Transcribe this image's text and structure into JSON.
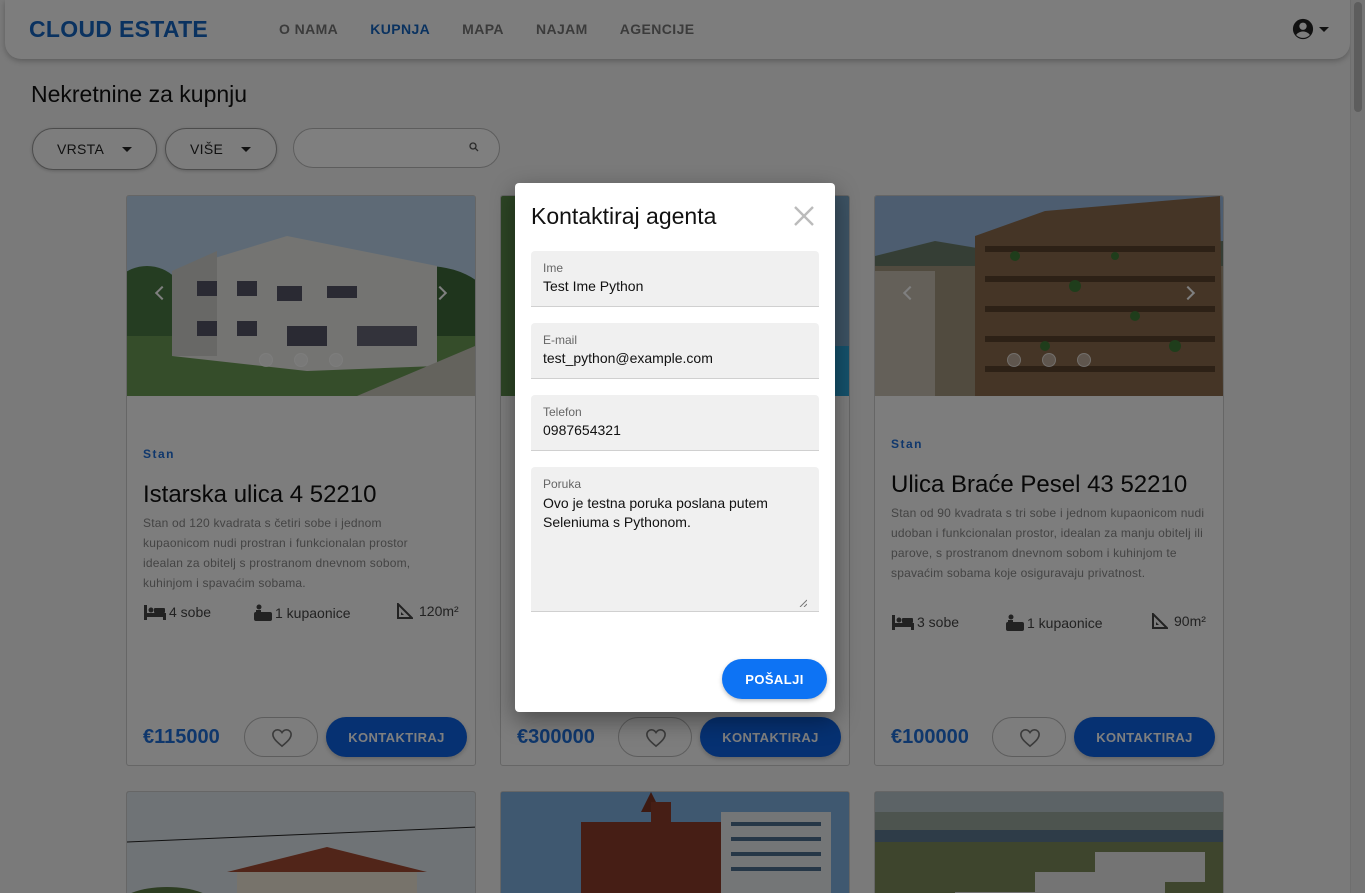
{
  "header": {
    "brand": "CLOUD ESTATE",
    "nav": [
      {
        "label": "O NAMA"
      },
      {
        "label": "KUPNJA",
        "active": true
      },
      {
        "label": "MAPA"
      },
      {
        "label": "NAJAM"
      },
      {
        "label": "AGENCIJE"
      }
    ],
    "account_icon": "account-circle-icon"
  },
  "page": {
    "title": "Nekretnine za kupnju",
    "filters": {
      "vrsta_label": "VRSTA",
      "vise_label": "VIŠE",
      "search_placeholder": ""
    }
  },
  "cards": [
    {
      "type": "Stan",
      "address": "Istarska ulica 4 52210",
      "description": "Stan od 120 kvadrata s četiri sobe i jednom kupaonicom nudi prostran i funkcionalan prostor idealan za obitelj s prostranom dnevnom sobom, kuhinjom i spavaćim sobama.",
      "rooms": "4 sobe",
      "bathrooms": "1 kupaonice",
      "area": "120m²",
      "price": "€115000",
      "contact_label": "KONTAKTIRAJ"
    },
    {
      "price": "€300000",
      "contact_label": "KONTAKTIRAJ"
    },
    {
      "type": "Stan",
      "address": "Ulica Braće Pesel 43 52210",
      "description": "Stan od 90 kvadrata s tri sobe i jednom kupaonicom nudi udoban i funkcionalan prostor, idealan za manju obitelj ili parove, s prostranom dnevnom sobom i kuhinjom te spavaćim sobama koje osiguravaju privatnost.",
      "rooms": "3 sobe",
      "bathrooms": "1 kupaonice",
      "area": "90m²",
      "price": "€100000",
      "contact_label": "KONTAKTIRAJ"
    }
  ],
  "modal": {
    "title": "Kontaktiraj agenta",
    "fields": {
      "ime_label": "Ime",
      "ime_value": "Test Ime Python",
      "email_label": "E-mail",
      "email_value": "test_python@example.com",
      "telefon_label": "Telefon",
      "telefon_value": "0987654321",
      "poruka_label": "Poruka",
      "poruka_value": "Ovo je testna poruka poslana putem Seleniuma s Pythonom."
    },
    "send_label": "POŠALJI"
  },
  "colors": {
    "brand": "#1565c0",
    "accent": "#0d63e4",
    "price": "#1e6fd9"
  }
}
